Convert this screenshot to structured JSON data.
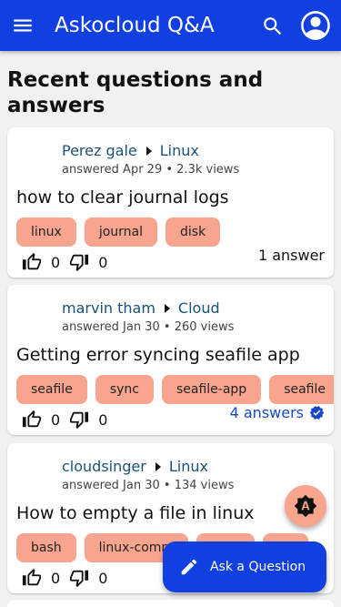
{
  "appbar": {
    "title": "Askocloud Q&A",
    "icons": {
      "menu": "menu-icon",
      "search": "search-icon",
      "account": "account-circle-icon"
    }
  },
  "page": {
    "heading": "Recent questions and answers"
  },
  "questions": [
    {
      "author": "Perez gale",
      "category": "Linux",
      "answered": "answered Apr 29",
      "views": "2.3k views",
      "title": "how to clear journal logs",
      "tags": [
        "linux",
        "journal",
        "disk"
      ],
      "upvotes": "0",
      "downvotes": "0",
      "answers": "1 answer",
      "accepted": false
    },
    {
      "author": "marvin tham",
      "category": "Cloud",
      "answered": "answered Jan 30",
      "views": "260 views",
      "title": "Getting error syncing seafile app",
      "tags": [
        "seafile",
        "sync",
        "seafile-app",
        "seafile"
      ],
      "upvotes": "0",
      "downvotes": "0",
      "answers": "4 answers",
      "accepted": true
    },
    {
      "author": "cloudsinger",
      "category": "Linux",
      "answered": "answered Jan 30",
      "views": "134 views",
      "title": "How to empty a file in linux",
      "tags": [
        "bash",
        "linux-comm",
        "",
        ""
      ],
      "upvotes": "0",
      "downvotes": "0",
      "answers": "",
      "accepted": false
    }
  ],
  "separator": "•",
  "fab": {
    "ask_label": "Ask a Question",
    "theme_icon": "brightness-auto-icon",
    "ask_icon": "pencil-icon"
  },
  "colors": {
    "primary": "#1240e0",
    "tag": "#f8a58f",
    "link": "#1a5276",
    "accepted": "#1848c8"
  }
}
